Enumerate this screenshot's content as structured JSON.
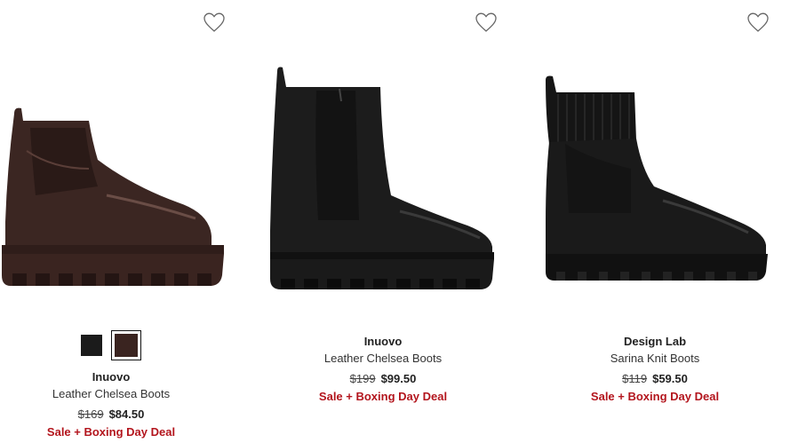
{
  "colors": {
    "promo": "#b3151d",
    "text": "#222222"
  },
  "products": [
    {
      "brand": "Inuovo",
      "name": "Leather Chelsea Boots",
      "was_price": "$169",
      "now_price": "$84.50",
      "promo": "Sale + Boxing Day Deal",
      "wishlist_icon": "heart-outline-icon",
      "swatches": [
        {
          "color": "#1b1b1b",
          "selected": false
        },
        {
          "color": "#3a2420",
          "selected": true
        }
      ],
      "boot_color": "#3b2622"
    },
    {
      "brand": "Inuovo",
      "name": "Leather Chelsea Boots",
      "was_price": "$199",
      "now_price": "$99.50",
      "promo": "Sale + Boxing Day Deal",
      "wishlist_icon": "heart-outline-icon",
      "swatches": [],
      "boot_color": "#1c1c1c"
    },
    {
      "brand": "Design Lab",
      "name": "Sarina Knit Boots",
      "was_price": "$119",
      "now_price": "$59.50",
      "promo": "Sale + Boxing Day Deal",
      "wishlist_icon": "heart-outline-icon",
      "swatches": [],
      "boot_color": "#1a1a1a"
    }
  ]
}
